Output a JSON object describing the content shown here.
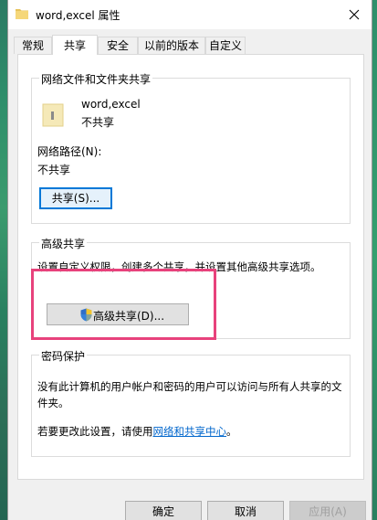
{
  "window": {
    "title": "word,excel 属性"
  },
  "tabs": [
    "常规",
    "共享",
    "安全",
    "以前的版本",
    "自定义"
  ],
  "network_sharing": {
    "group_title": "网络文件和文件夹共享",
    "folder_name": "word,excel",
    "folder_status": "不共享",
    "path_label": "网络路径(N):",
    "path_value": "不共享",
    "share_button": "共享(S)..."
  },
  "advanced_sharing": {
    "group_title": "高级共享",
    "description": "设置自定义权限，创建多个共享，并设置其他高级共享选项。",
    "button": "高级共享(D)..."
  },
  "password_protection": {
    "group_title": "密码保护",
    "description_line1": "没有此计算机的用户帐户和密码的用户可以访问与所有人共享的文",
    "description_line2": "件夹。",
    "change_prefix": "若要更改此设置，请使用",
    "link": "网络和共享中心",
    "change_suffix": "。"
  },
  "footer": {
    "ok": "确定",
    "cancel": "取消",
    "apply": "应用(A)"
  },
  "colors": {
    "highlight": "#e8427c",
    "focus": "#0078d7",
    "link": "#0066cc"
  }
}
